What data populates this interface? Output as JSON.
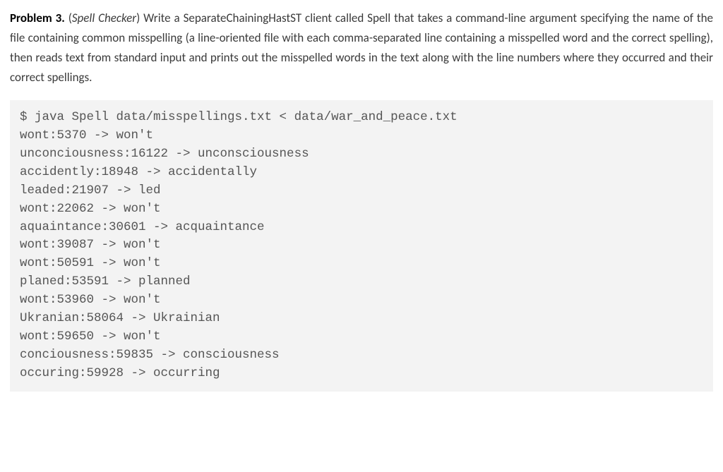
{
  "problem": {
    "label": "Problem 3.",
    "title": "Spell Checker",
    "description": "Write a SeparateChainingHastST client called Spell that takes a command-line argument specifying the name of the file containing common misspelling (a line-oriented file with each comma-separated line containing a misspelled word and the correct spelling), then reads text from standard input and prints out the misspelled words in the text along with the line numbers where they occurred and their correct spellings."
  },
  "code_output": {
    "command": "$ java Spell data/misspellings.txt < data/war_and_peace.txt",
    "lines": [
      "wont:5370 -> won't",
      "unconciousness:16122 -> unconsciousness",
      "accidently:18948 -> accidentally",
      "leaded:21907 -> led",
      "wont:22062 -> won't",
      "aquaintance:30601 -> acquaintance",
      "wont:39087 -> won't",
      "wont:50591 -> won't",
      "planed:53591 -> planned",
      "wont:53960 -> won't",
      "Ukranian:58064 -> Ukrainian",
      "wont:59650 -> won't",
      "conciousness:59835 -> consciousness",
      "occuring:59928 -> occurring"
    ]
  }
}
